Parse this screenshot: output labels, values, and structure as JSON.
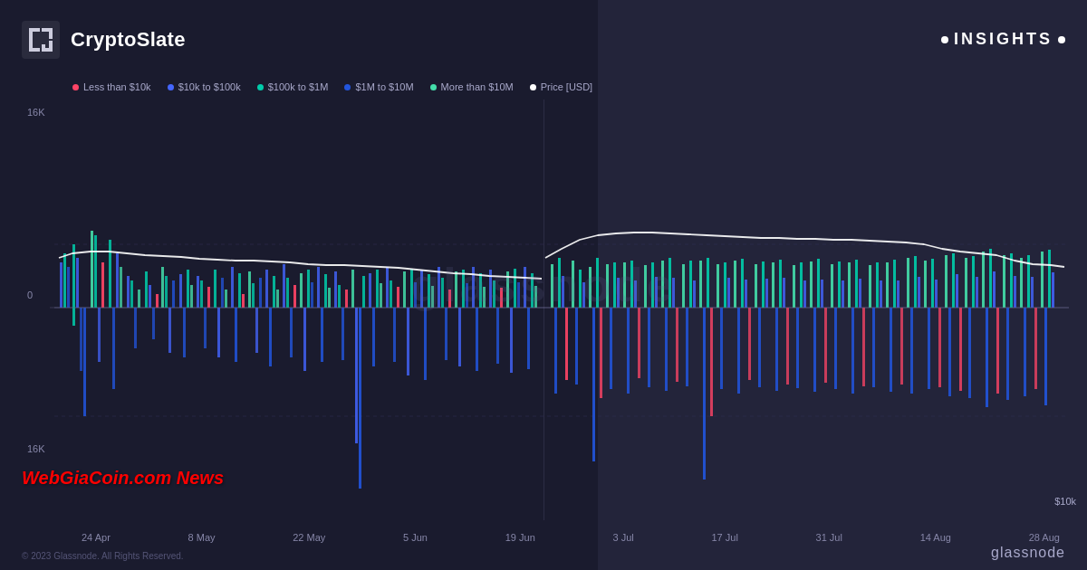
{
  "header": {
    "logo_text": "CryptoSlate",
    "insights_label": "INSIGHTS"
  },
  "legend": {
    "items": [
      {
        "label": "Less than $10k",
        "color": "#ff4466"
      },
      {
        "label": "$10k to $100k",
        "color": "#4466ff"
      },
      {
        "label": "$100k to $1M",
        "color": "#00ccaa"
      },
      {
        "label": "$1M to $10M",
        "color": "#2255dd"
      },
      {
        "label": "More than $10M",
        "color": "#44ddaa"
      },
      {
        "label": "Price [USD]",
        "color": "#ffffff"
      }
    ]
  },
  "chart": {
    "y_top": "16K",
    "y_mid": "0",
    "y_bot": "16K",
    "price_label": "$10k",
    "x_labels": [
      "24 Apr",
      "8 May",
      "22 May",
      "5 Jun",
      "19 Jun",
      "3 Jul",
      "17 Jul",
      "31 Jul",
      "14 Aug",
      "28 Aug"
    ]
  },
  "watermark": "glassnode",
  "news_overlay": "WebGiaCoin.com News",
  "copyright": "© 2023 Glassnode. All Rights Reserved.",
  "glassnode_label": "glassnode"
}
